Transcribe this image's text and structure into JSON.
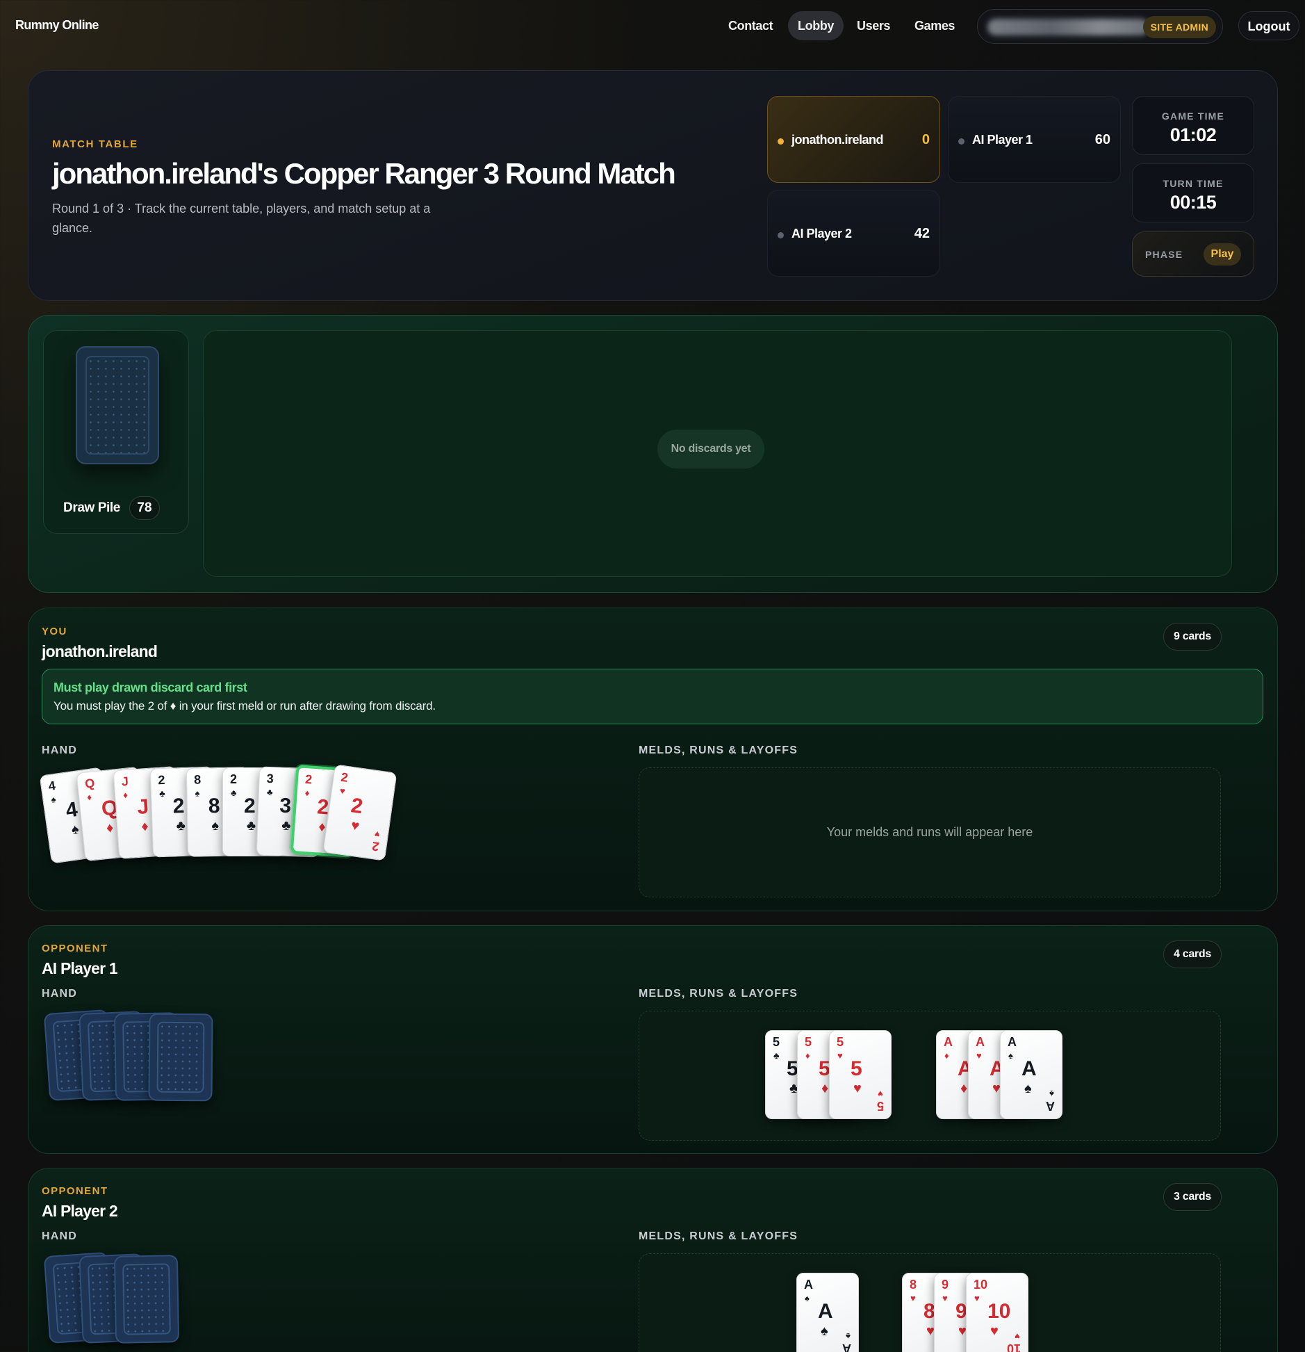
{
  "nav": {
    "brand": "Rummy Online",
    "links": [
      "Contact",
      "Lobby",
      "Users",
      "Games"
    ],
    "active_link": "Lobby",
    "admin_badge": "SITE ADMIN",
    "logout": "Logout"
  },
  "header": {
    "eyebrow": "MATCH TABLE",
    "title": "jonathon.ireland's Copper Ranger 3 Round Match",
    "subtitle": "Round 1 of 3 · Track the current table, players, and match setup at a glance.",
    "players": [
      {
        "name": "jonathon.ireland",
        "score": "0",
        "active": true
      },
      {
        "name": "AI Player 1",
        "score": "60",
        "active": false
      },
      {
        "name": "AI Player 2",
        "score": "42",
        "active": false
      }
    ],
    "game_time_label": "GAME TIME",
    "game_time": "01:02",
    "turn_time_label": "TURN TIME",
    "turn_time": "00:15",
    "phase_label": "PHASE",
    "phase": "Play",
    "accent_color": "#e2a63a"
  },
  "table": {
    "draw_label": "Draw Pile",
    "draw_count": "78",
    "discard_empty": "No discards yet"
  },
  "you": {
    "eyebrow": "YOU",
    "name": "jonathon.ireland",
    "card_count": "9 cards",
    "alert_title": "Must play drawn discard card first",
    "alert_body": "You must play the 2 of ♦ in your first meld or run after drawing from discard.",
    "hand_label": "HAND",
    "melds_label": "MELDS, RUNS & LAYOFFS",
    "melds_placeholder": "Your melds and runs will appear here",
    "hand": [
      {
        "rank": "4",
        "suit": "♠",
        "color": "black"
      },
      {
        "rank": "Q",
        "suit": "♦",
        "color": "red"
      },
      {
        "rank": "J",
        "suit": "♦",
        "color": "red"
      },
      {
        "rank": "2",
        "suit": "♣",
        "color": "black"
      },
      {
        "rank": "8",
        "suit": "♠",
        "color": "black"
      },
      {
        "rank": "2",
        "suit": "♣",
        "color": "black"
      },
      {
        "rank": "3",
        "suit": "♣",
        "color": "black"
      },
      {
        "rank": "2",
        "suit": "♦",
        "color": "red",
        "selected": true
      },
      {
        "rank": "2",
        "suit": "♥",
        "color": "red"
      }
    ]
  },
  "opponent1": {
    "eyebrow": "OPPONENT",
    "name": "AI Player 1",
    "card_count": "4 cards",
    "hand_label": "HAND",
    "melds_label": "MELDS, RUNS & LAYOFFS",
    "hidden_cards": 4,
    "melds": [
      [
        {
          "rank": "5",
          "suit": "♣",
          "color": "black"
        },
        {
          "rank": "5",
          "suit": "♦",
          "color": "red"
        },
        {
          "rank": "5",
          "suit": "♥",
          "color": "red"
        }
      ],
      [
        {
          "rank": "A",
          "suit": "♦",
          "color": "red"
        },
        {
          "rank": "A",
          "suit": "♥",
          "color": "red"
        },
        {
          "rank": "A",
          "suit": "♠",
          "color": "black"
        }
      ]
    ]
  },
  "opponent2": {
    "eyebrow": "OPPONENT",
    "name": "AI Player 2",
    "card_count": "3 cards",
    "hand_label": "HAND",
    "melds_label": "MELDS, RUNS & LAYOFFS",
    "hidden_cards": 3,
    "melds": [
      [
        {
          "rank": "A",
          "suit": "♠",
          "color": "black"
        }
      ],
      [
        {
          "rank": "8",
          "suit": "♥",
          "color": "red"
        },
        {
          "rank": "9",
          "suit": "♥",
          "color": "red"
        },
        {
          "rank": "10",
          "suit": "♥",
          "color": "red"
        }
      ]
    ]
  }
}
